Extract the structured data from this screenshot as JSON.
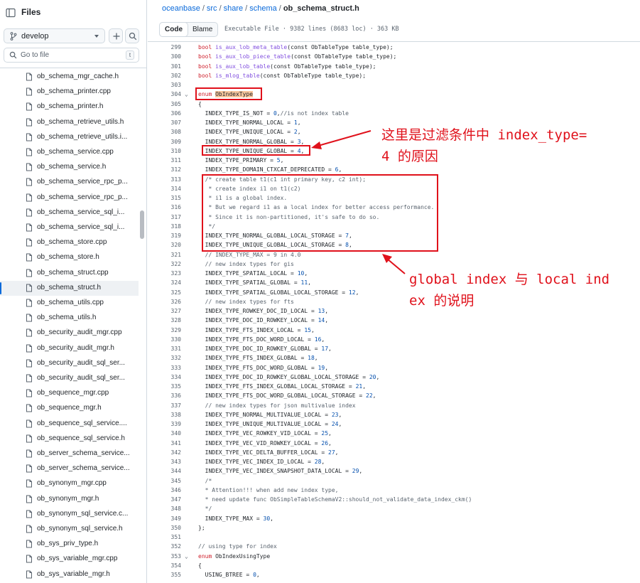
{
  "sidebar": {
    "title": "Files",
    "branch": "develop",
    "goto_placeholder": "Go to file",
    "goto_shortcut": "t",
    "files": [
      "ob_schema_mgr_cache.h",
      "ob_schema_printer.cpp",
      "ob_schema_printer.h",
      "ob_schema_retrieve_utils.h",
      "ob_schema_retrieve_utils.i...",
      "ob_schema_service.cpp",
      "ob_schema_service.h",
      "ob_schema_service_rpc_p...",
      "ob_schema_service_rpc_p...",
      "ob_schema_service_sql_i...",
      "ob_schema_service_sql_i...",
      "ob_schema_store.cpp",
      "ob_schema_store.h",
      "ob_schema_struct.cpp",
      "ob_schema_struct.h",
      "ob_schema_utils.cpp",
      "ob_schema_utils.h",
      "ob_security_audit_mgr.cpp",
      "ob_security_audit_mgr.h",
      "ob_security_audit_sql_ser...",
      "ob_security_audit_sql_ser...",
      "ob_sequence_mgr.cpp",
      "ob_sequence_mgr.h",
      "ob_sequence_sql_service....",
      "ob_sequence_sql_service.h",
      "ob_server_schema_service...",
      "ob_server_schema_service...",
      "ob_synonym_mgr.cpp",
      "ob_synonym_mgr.h",
      "ob_synonym_sql_service.c...",
      "ob_synonym_sql_service.h",
      "ob_sys_priv_type.h",
      "ob_sys_variable_mgr.cpp",
      "ob_sys_variable_mgr.h"
    ],
    "active_file": "ob_schema_struct.h"
  },
  "breadcrumb": {
    "repo": "oceanbase",
    "parts": [
      "src",
      "share",
      "schema"
    ],
    "current": "ob_schema_struct.h"
  },
  "toolbar": {
    "code_tab": "Code",
    "blame_tab": "Blame",
    "file_info": "Executable File · 9382 lines (8683 loc) · 363 KB"
  },
  "code_lines": [
    {
      "n": "299",
      "segs": [
        [
          "kw",
          "bool "
        ],
        [
          "fn",
          "is_aux_lob_meta_table"
        ],
        [
          "",
          "(const ObTableType table_type);"
        ]
      ]
    },
    {
      "n": "300",
      "segs": [
        [
          "kw",
          "bool "
        ],
        [
          "fn",
          "is_aux_lob_piece_table"
        ],
        [
          "",
          "(const ObTableType table_type);"
        ]
      ]
    },
    {
      "n": "301",
      "segs": [
        [
          "kw",
          "bool "
        ],
        [
          "fn",
          "is_aux_lob_table"
        ],
        [
          "",
          "(const ObTableType table_type);"
        ]
      ]
    },
    {
      "n": "302",
      "segs": [
        [
          "kw",
          "bool "
        ],
        [
          "fn",
          "is_mlog_table"
        ],
        [
          "",
          "(const ObTableType table_type);"
        ]
      ]
    },
    {
      "n": "303",
      "segs": []
    },
    {
      "n": "304",
      "fold": true,
      "segs": [
        [
          "kw",
          "enum "
        ],
        [
          "hl",
          "ObIndexType"
        ]
      ]
    },
    {
      "n": "305",
      "segs": [
        [
          "",
          "{"
        ]
      ]
    },
    {
      "n": "306",
      "segs": [
        [
          "",
          "  INDEX_TYPE_IS_NOT = "
        ],
        [
          "num",
          "0"
        ],
        [
          "",
          ","
        ],
        [
          "cm",
          "//is not index table"
        ]
      ]
    },
    {
      "n": "307",
      "segs": [
        [
          "",
          "  INDEX_TYPE_NORMAL_LOCAL = "
        ],
        [
          "num",
          "1"
        ],
        [
          "",
          ","
        ]
      ]
    },
    {
      "n": "308",
      "segs": [
        [
          "",
          "  INDEX_TYPE_UNIQUE_LOCAL = "
        ],
        [
          "num",
          "2"
        ],
        [
          "",
          ","
        ]
      ]
    },
    {
      "n": "309",
      "segs": [
        [
          "",
          "  INDEX_TYPE_NORMAL_GLOBAL = "
        ],
        [
          "num",
          "3"
        ],
        [
          "",
          ","
        ]
      ]
    },
    {
      "n": "310",
      "segs": [
        [
          "",
          "  INDEX_TYPE_UNIQUE_GLOBAL = "
        ],
        [
          "num",
          "4"
        ],
        [
          "",
          ","
        ]
      ]
    },
    {
      "n": "311",
      "segs": [
        [
          "",
          "  INDEX_TYPE_PRIMARY = "
        ],
        [
          "num",
          "5"
        ],
        [
          "",
          ","
        ]
      ]
    },
    {
      "n": "312",
      "segs": [
        [
          "",
          "  INDEX_TYPE_DOMAIN_CTXCAT_DEPRECATED = "
        ],
        [
          "num",
          "6"
        ],
        [
          "",
          ","
        ]
      ]
    },
    {
      "n": "313",
      "segs": [
        [
          "cm",
          "  /* create table t1(c1 int primary key, c2 int);"
        ]
      ]
    },
    {
      "n": "314",
      "segs": [
        [
          "cm",
          "   * create index i1 on t1(c2)"
        ]
      ]
    },
    {
      "n": "315",
      "segs": [
        [
          "cm",
          "   * i1 is a global index."
        ]
      ]
    },
    {
      "n": "316",
      "segs": [
        [
          "cm",
          "   * But we regard i1 as a local index for better access performance."
        ]
      ]
    },
    {
      "n": "317",
      "segs": [
        [
          "cm",
          "   * Since it is non-partitioned, it's safe to do so."
        ]
      ]
    },
    {
      "n": "318",
      "segs": [
        [
          "cm",
          "   */"
        ]
      ]
    },
    {
      "n": "319",
      "segs": [
        [
          "",
          "  INDEX_TYPE_NORMAL_GLOBAL_LOCAL_STORAGE = "
        ],
        [
          "num",
          "7"
        ],
        [
          "",
          ","
        ]
      ]
    },
    {
      "n": "320",
      "segs": [
        [
          "",
          "  INDEX_TYPE_UNIQUE_GLOBAL_LOCAL_STORAGE = "
        ],
        [
          "num",
          "8"
        ],
        [
          "",
          ","
        ]
      ]
    },
    {
      "n": "321",
      "segs": [
        [
          "cm",
          "  // INDEX_TYPE_MAX = 9 in 4.0"
        ]
      ]
    },
    {
      "n": "322",
      "segs": [
        [
          "cm",
          "  // new index types for gis"
        ]
      ]
    },
    {
      "n": "323",
      "segs": [
        [
          "",
          "  INDEX_TYPE_SPATIAL_LOCAL = "
        ],
        [
          "num",
          "10"
        ],
        [
          "",
          ","
        ]
      ]
    },
    {
      "n": "324",
      "segs": [
        [
          "",
          "  INDEX_TYPE_SPATIAL_GLOBAL = "
        ],
        [
          "num",
          "11"
        ],
        [
          "",
          ","
        ]
      ]
    },
    {
      "n": "325",
      "segs": [
        [
          "",
          "  INDEX_TYPE_SPATIAL_GLOBAL_LOCAL_STORAGE = "
        ],
        [
          "num",
          "12"
        ],
        [
          "",
          ","
        ]
      ]
    },
    {
      "n": "326",
      "segs": [
        [
          "cm",
          "  // new index types for fts"
        ]
      ]
    },
    {
      "n": "327",
      "segs": [
        [
          "",
          "  INDEX_TYPE_ROWKEY_DOC_ID_LOCAL = "
        ],
        [
          "num",
          "13"
        ],
        [
          "",
          ","
        ]
      ]
    },
    {
      "n": "328",
      "segs": [
        [
          "",
          "  INDEX_TYPE_DOC_ID_ROWKEY_LOCAL = "
        ],
        [
          "num",
          "14"
        ],
        [
          "",
          ","
        ]
      ]
    },
    {
      "n": "329",
      "segs": [
        [
          "",
          "  INDEX_TYPE_FTS_INDEX_LOCAL = "
        ],
        [
          "num",
          "15"
        ],
        [
          "",
          ","
        ]
      ]
    },
    {
      "n": "330",
      "segs": [
        [
          "",
          "  INDEX_TYPE_FTS_DOC_WORD_LOCAL = "
        ],
        [
          "num",
          "16"
        ],
        [
          "",
          ","
        ]
      ]
    },
    {
      "n": "331",
      "segs": [
        [
          "",
          "  INDEX_TYPE_DOC_ID_ROWKEY_GLOBAL = "
        ],
        [
          "num",
          "17"
        ],
        [
          "",
          ","
        ]
      ]
    },
    {
      "n": "332",
      "segs": [
        [
          "",
          "  INDEX_TYPE_FTS_INDEX_GLOBAL = "
        ],
        [
          "num",
          "18"
        ],
        [
          "",
          ","
        ]
      ]
    },
    {
      "n": "333",
      "segs": [
        [
          "",
          "  INDEX_TYPE_FTS_DOC_WORD_GLOBAL = "
        ],
        [
          "num",
          "19"
        ],
        [
          "",
          ","
        ]
      ]
    },
    {
      "n": "334",
      "segs": [
        [
          "",
          "  INDEX_TYPE_DOC_ID_ROWKEY_GLOBAL_LOCAL_STORAGE = "
        ],
        [
          "num",
          "20"
        ],
        [
          "",
          ","
        ]
      ]
    },
    {
      "n": "335",
      "segs": [
        [
          "",
          "  INDEX_TYPE_FTS_INDEX_GLOBAL_LOCAL_STORAGE = "
        ],
        [
          "num",
          "21"
        ],
        [
          "",
          ","
        ]
      ]
    },
    {
      "n": "336",
      "segs": [
        [
          "",
          "  INDEX_TYPE_FTS_DOC_WORD_GLOBAL_LOCAL_STORAGE = "
        ],
        [
          "num",
          "22"
        ],
        [
          "",
          ","
        ]
      ]
    },
    {
      "n": "337",
      "segs": [
        [
          "cm",
          "  // new index types for json multivalue index"
        ]
      ]
    },
    {
      "n": "338",
      "segs": [
        [
          "",
          "  INDEX_TYPE_NORMAL_MULTIVALUE_LOCAL = "
        ],
        [
          "num",
          "23"
        ],
        [
          "",
          ","
        ]
      ]
    },
    {
      "n": "339",
      "segs": [
        [
          "",
          "  INDEX_TYPE_UNIQUE_MULTIVALUE_LOCAL = "
        ],
        [
          "num",
          "24"
        ],
        [
          "",
          ","
        ]
      ]
    },
    {
      "n": "340",
      "segs": [
        [
          "",
          "  INDEX_TYPE_VEC_ROWKEY_VID_LOCAL = "
        ],
        [
          "num",
          "25"
        ],
        [
          "",
          ","
        ]
      ]
    },
    {
      "n": "341",
      "segs": [
        [
          "",
          "  INDEX_TYPE_VEC_VID_ROWKEY_LOCAL = "
        ],
        [
          "num",
          "26"
        ],
        [
          "",
          ","
        ]
      ]
    },
    {
      "n": "342",
      "segs": [
        [
          "",
          "  INDEX_TYPE_VEC_DELTA_BUFFER_LOCAL = "
        ],
        [
          "num",
          "27"
        ],
        [
          "",
          ","
        ]
      ]
    },
    {
      "n": "343",
      "segs": [
        [
          "",
          "  INDEX_TYPE_VEC_INDEX_ID_LOCAL = "
        ],
        [
          "num",
          "28"
        ],
        [
          "",
          ","
        ]
      ]
    },
    {
      "n": "344",
      "segs": [
        [
          "",
          "  INDEX_TYPE_VEC_INDEX_SNAPSHOT_DATA_LOCAL = "
        ],
        [
          "num",
          "29"
        ],
        [
          "",
          ","
        ]
      ]
    },
    {
      "n": "345",
      "segs": [
        [
          "cm",
          "  /*"
        ]
      ]
    },
    {
      "n": "346",
      "segs": [
        [
          "cm",
          "  * Attention!!! when add new index type,"
        ]
      ]
    },
    {
      "n": "347",
      "segs": [
        [
          "cm",
          "  * need update func ObSimpleTableSchemaV2::should_not_validate_data_index_ckm()"
        ]
      ]
    },
    {
      "n": "348",
      "segs": [
        [
          "cm",
          "  */"
        ]
      ]
    },
    {
      "n": "349",
      "segs": [
        [
          "",
          "  INDEX_TYPE_MAX = "
        ],
        [
          "num",
          "30"
        ],
        [
          "",
          ","
        ]
      ]
    },
    {
      "n": "350",
      "segs": [
        [
          "",
          "};"
        ]
      ]
    },
    {
      "n": "351",
      "segs": []
    },
    {
      "n": "352",
      "segs": [
        [
          "cm",
          "// using type for index"
        ]
      ]
    },
    {
      "n": "353",
      "fold": true,
      "segs": [
        [
          "kw",
          "enum "
        ],
        [
          "",
          "ObIndexUsingType"
        ]
      ]
    },
    {
      "n": "354",
      "segs": [
        [
          "",
          "{"
        ]
      ]
    },
    {
      "n": "355",
      "segs": [
        [
          "",
          "  USING_BTREE = "
        ],
        [
          "num",
          "0"
        ],
        [
          "",
          ","
        ]
      ]
    }
  ],
  "annotations": {
    "note1_line1": "这里是过滤条件中 index_type=",
    "note1_line2": "4 的原因",
    "note2_line1": "global index 与 local ind",
    "note2_line2": "ex 的说明"
  }
}
